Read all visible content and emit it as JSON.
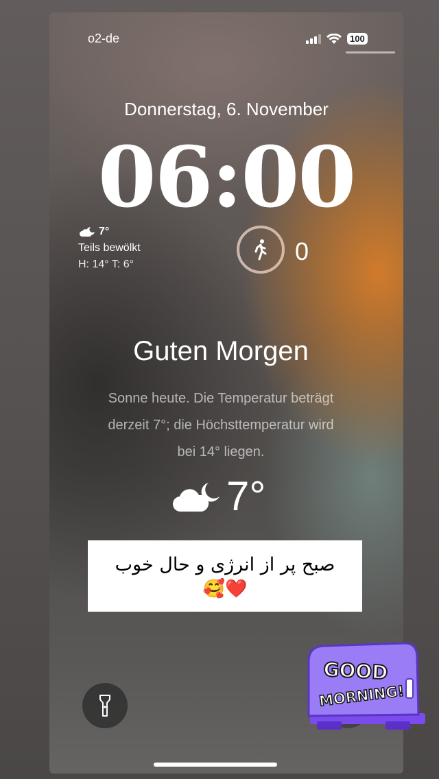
{
  "status_bar": {
    "carrier": "o2-de",
    "battery": "100"
  },
  "lock_screen": {
    "date": "Donnerstag, 6. November",
    "time": "06:00"
  },
  "weather_widget": {
    "temperature": "7°",
    "condition": "Teils bewölkt",
    "high_low": "H: 14° T: 6°"
  },
  "activity_widget": {
    "count": "0"
  },
  "summary_card": {
    "greeting": "Guten Morgen",
    "lines": [
      "Sonne heute. Die Temperatur beträgt",
      "derzeit 7°; die Höchsttemperatur wird",
      "bei 14° liegen."
    ],
    "temperature": "7°"
  },
  "story_text": {
    "persian": "صبح پر از انرژی و حال خوب",
    "emoji": "🥰❤️"
  },
  "sticker": {
    "line1": "GOOD",
    "line2": "MORNING!"
  },
  "colors": {
    "accent_orange": "#d07a28",
    "sticker_purple": "#8c6cf0"
  }
}
